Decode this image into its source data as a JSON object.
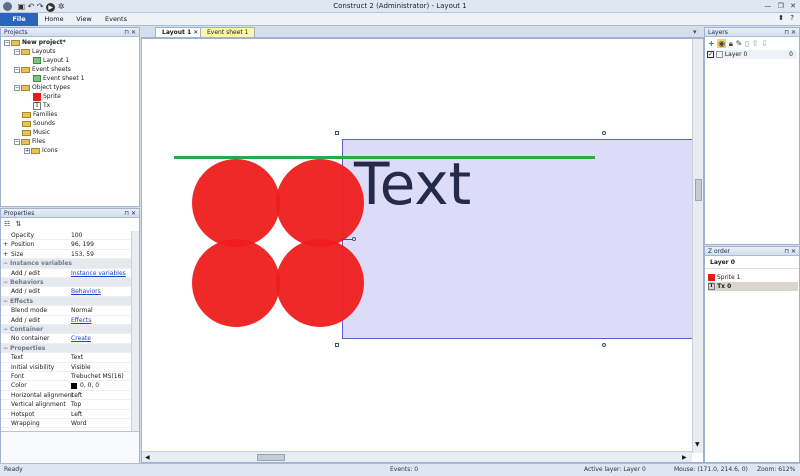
{
  "window": {
    "title": "Construct 2 (Administrator) - Layout 1"
  },
  "ribbon": {
    "tabs": [
      "File",
      "Home",
      "View",
      "Events"
    ]
  },
  "projects_panel": {
    "title": "Projects",
    "items": [
      {
        "label": "New project*"
      },
      {
        "label": "Layouts"
      },
      {
        "label": "Layout 1"
      },
      {
        "label": "Event sheets"
      },
      {
        "label": "Event sheet 1"
      },
      {
        "label": "Object types"
      },
      {
        "label": "Sprite"
      },
      {
        "label": "Tx"
      },
      {
        "label": "Families"
      },
      {
        "label": "Sounds"
      },
      {
        "label": "Music"
      },
      {
        "label": "Files"
      },
      {
        "label": "Icons"
      }
    ]
  },
  "properties_panel": {
    "title": "Properties",
    "rows": [
      {
        "k": "Opacity",
        "v": "100"
      },
      {
        "k": "Position",
        "v": "96, 199"
      },
      {
        "k": "Size",
        "v": "153, 59"
      },
      {
        "k": "Instance variables",
        "v": "",
        "cat": true
      },
      {
        "k": "Add / edit",
        "v": "Instance variables",
        "link": true
      },
      {
        "k": "Behaviors",
        "v": "",
        "cat": true
      },
      {
        "k": "Add / edit",
        "v": "Behaviors",
        "link": true
      },
      {
        "k": "Effects",
        "v": "",
        "cat": true
      },
      {
        "k": "Blend mode",
        "v": "Normal"
      },
      {
        "k": "Add / edit",
        "v": "Effects",
        "link": true
      },
      {
        "k": "Container",
        "v": "",
        "cat": true
      },
      {
        "k": "No container",
        "v": "Create",
        "link": true
      },
      {
        "k": "Properties",
        "v": "",
        "cat": true
      },
      {
        "k": "Text",
        "v": "Text"
      },
      {
        "k": "Initial visibility",
        "v": "Visible"
      },
      {
        "k": "Font",
        "v": "Trebuchet MS(16)"
      },
      {
        "k": "Color",
        "v": "0, 0, 0"
      },
      {
        "k": "Horizontal alignment",
        "v": "Left"
      },
      {
        "k": "Vertical alignment",
        "v": "Top"
      },
      {
        "k": "Hotspot",
        "v": "Left"
      },
      {
        "k": "Wrapping",
        "v": "Word"
      }
    ]
  },
  "doc_tabs": [
    "Layout 1",
    "Event sheet 1"
  ],
  "canvas": {
    "text_object": "Text"
  },
  "layers_panel": {
    "title": "Layers",
    "layer": "Layer 0",
    "layer_index": "0"
  },
  "zorder_panel": {
    "title": "Z order",
    "layer": "Layer 0",
    "items": [
      "Sprite 1",
      "Tx 0"
    ]
  },
  "status": {
    "ready": "Ready",
    "events": "Events: 0",
    "active_layer": "Active layer: Layer 0",
    "mouse": "Mouse: (171.0, 214.6, 0)",
    "zoom": "Zoom: 612%"
  },
  "colors": {
    "file_tab": "#2b64b8",
    "sprite_red": "#ee1c1c",
    "selection_fill": "#dcdcf8",
    "guide_green": "#2aa84a",
    "active_tab": "#fff4b0"
  }
}
